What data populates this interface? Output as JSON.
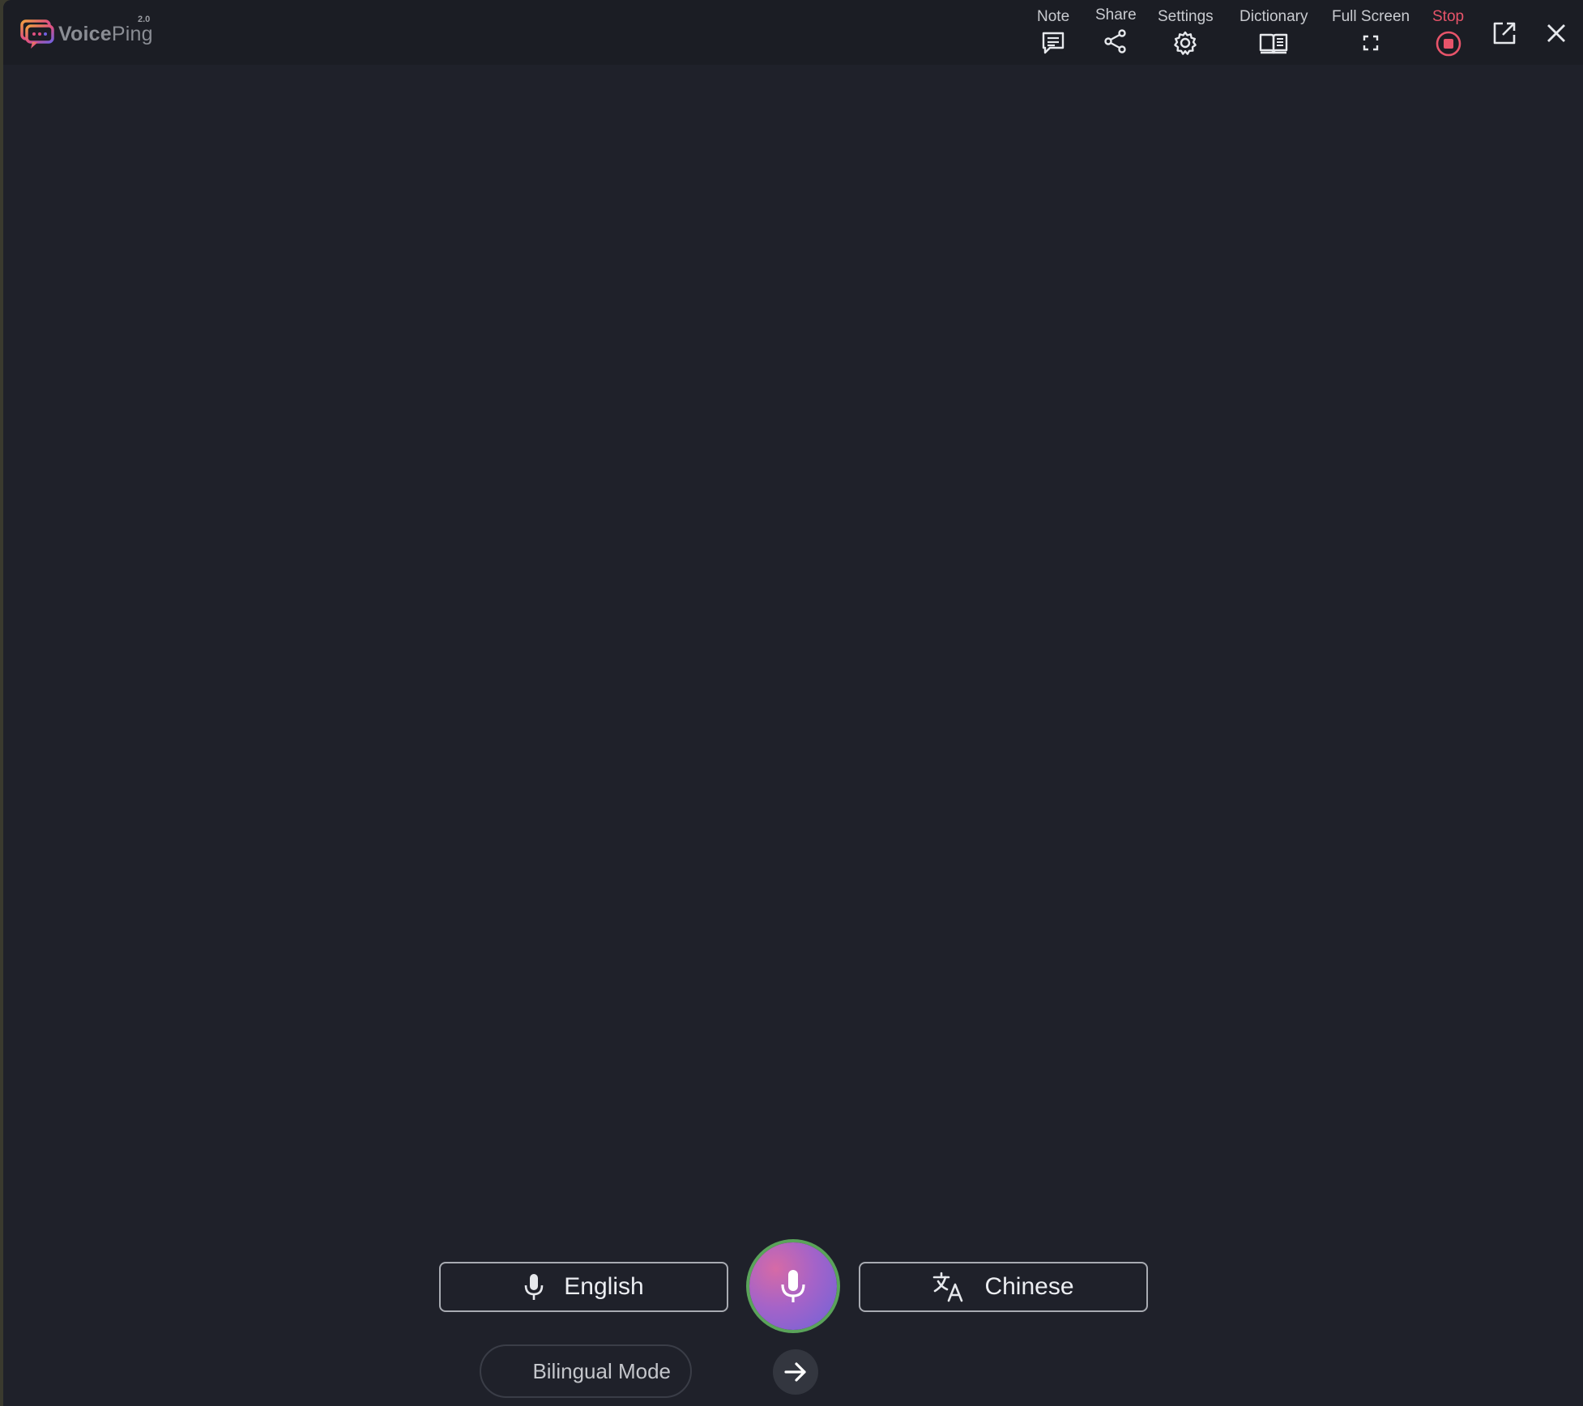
{
  "app": {
    "name_bold": "Voice",
    "name_light": "Ping",
    "version": "2.0"
  },
  "toolbar": {
    "note": {
      "label": "Note",
      "icon": "note-icon"
    },
    "share": {
      "label": "Share",
      "icon": "share-icon"
    },
    "settings": {
      "label": "Settings",
      "icon": "gear-icon"
    },
    "dictionary": {
      "label": "Dictionary",
      "icon": "book-icon"
    },
    "fullscreen": {
      "label": "Full Screen",
      "icon": "fullscreen-icon"
    },
    "stop": {
      "label": "Stop",
      "icon": "stop-record-icon"
    },
    "popout_icon": "external-link-icon",
    "close_icon": "close-icon"
  },
  "controls": {
    "source_language": "English",
    "target_language": "Chinese",
    "bilingual_mode": "Bilingual Mode",
    "mic_icon": "microphone-icon",
    "swap_icon": "arrow-right-icon"
  },
  "colors": {
    "background": "#1f212a",
    "titlebar": "#1b1d24",
    "stop_accent": "#e8546a",
    "mic_gradient_start": "#d66aa6",
    "mic_gradient_end": "#6e63d9",
    "mic_ring": "#5aa35a"
  }
}
